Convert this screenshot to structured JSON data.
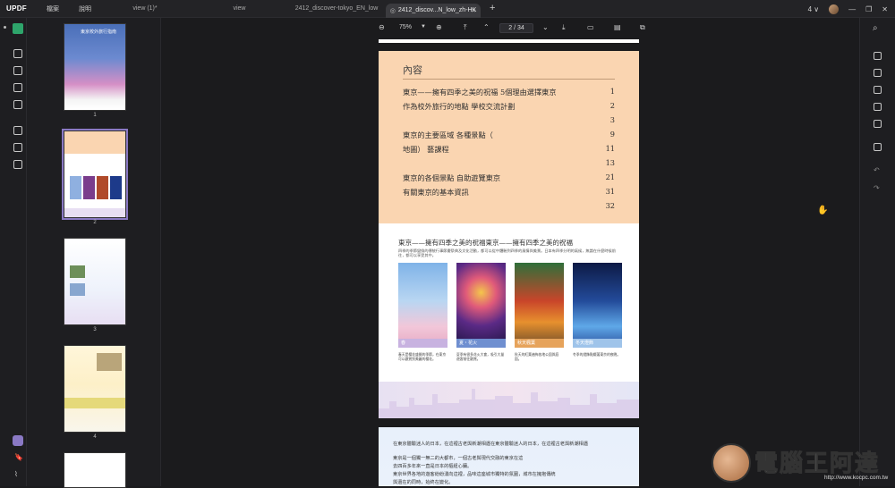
{
  "app": {
    "logo": "UPDF"
  },
  "menu": [
    "檔案",
    "說明"
  ],
  "tabs": [
    {
      "label": "view (1)*",
      "active": false
    },
    {
      "label": "view",
      "active": false
    },
    {
      "label": "2412_discover-tokyo_EN_low",
      "active": false
    },
    {
      "label": "2412_discov...N_low_zh-HK",
      "active": true
    }
  ],
  "window": {
    "count": "4"
  },
  "toolbar": {
    "zoom": "75%",
    "page_indicator": "2 / 34"
  },
  "thumbnails": [
    {
      "page": "1",
      "cover_title": "東京校外旅行指南"
    },
    {
      "page": "2"
    },
    {
      "page": "3"
    },
    {
      "page": "4"
    }
  ],
  "document": {
    "toc_title": "內容",
    "toc": [
      {
        "text": "東京——擁有四季之美的祝福 5個理由選擇東京",
        "page": "1"
      },
      {
        "text": "作為校外旅行的地點 學校交流計劃",
        "page": "2"
      },
      {
        "text": "",
        "page": "3"
      },
      {
        "text": "東京的主要區域 各種景點（",
        "page": "9"
      },
      {
        "text": "地圖） 藝課程",
        "page": "11"
      },
      {
        "text": "",
        "page": "13"
      },
      {
        "text": "東京的各個景點 自助遊覽東京",
        "page": "21"
      },
      {
        "text": "有關東京的基本資訊",
        "page": "31"
      },
      {
        "text": "",
        "page": "32"
      }
    ],
    "section_title": "東京——擁有四季之美的祝福東京——擁有四季之美的祝福",
    "section_sub": "四季的季節變換的傳統行事節慶祭典及文化活動，都可以從中體驗到四季的風情與美景。日本有四季分明的氣候，無論在什麼時候前往，都可以享受其中。",
    "photos": [
      {
        "caption": "春",
        "text": "春天是櫻花盛開的季節，在東京可以觀賞到美麗的櫻花。"
      },
      {
        "caption": "夏・花火",
        "text": "夏季有很多花火大會，吸引大量遊客前往觀賞。"
      },
      {
        "caption": "秋天楓葉",
        "text": "秋天的紅葉遍佈各地公園與庭園。"
      },
      {
        "caption": "冬天燈飾",
        "text": "冬季的燈飾點綴著東京的夜晚。"
      }
    ],
    "page2_lines": [
      "在東京體驗迷人的日本，在這裡古老與新潮相遇在東京體驗迷人的日本，在這裡古老與新潮相遇",
      "東京是一個獨一無二的大都市，一個古老與現代交融的東京在這",
      "去四百多年來一直是日本的樞紐心臟。",
      "東京世界各地的遊客紛紛湧向這裡，品味這座城市獨特的氛圍，城市在擁抱傳統",
      "與還在的同時，始終在變化。"
    ]
  },
  "watermark": {
    "text": "電腦王阿達",
    "url": "http://www.kocpc.com.tw"
  },
  "colors": {
    "toc_bg": "#fad5b1",
    "accent": "#8a79c4",
    "brand_green": "#2ea56b"
  }
}
